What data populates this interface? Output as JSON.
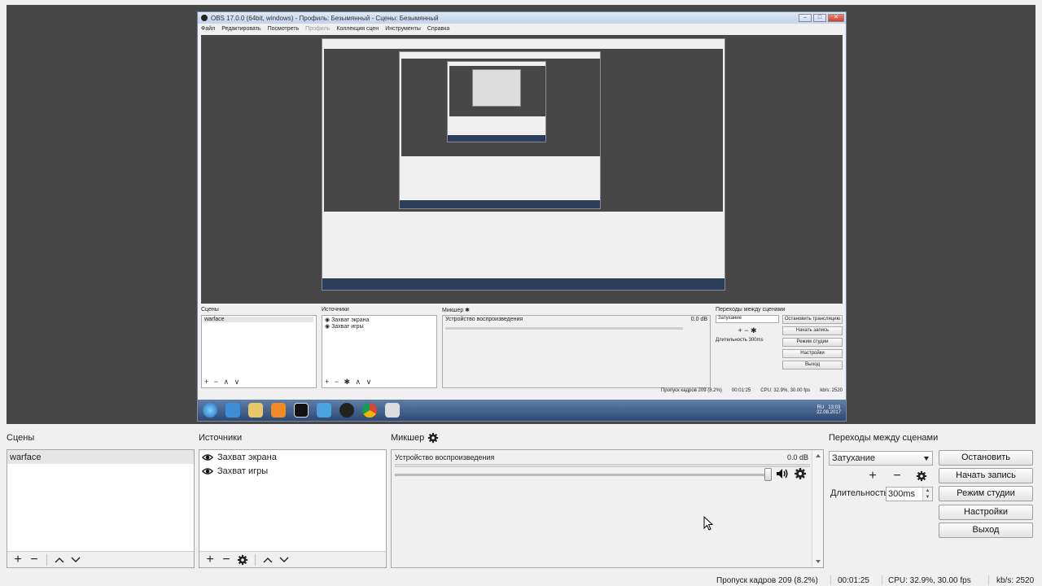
{
  "preview": {
    "window_title": "OBS 17.0.0 (64bit, windows) - Профиль: Безымянный - Сцены: Безымянный",
    "menu": [
      "Файл",
      "Редактировать",
      "Посмотреть",
      "Профиль",
      "Коллекция сцен",
      "Инструменты",
      "Справка"
    ],
    "docks": {
      "scenes_label": "Сцены",
      "sources_label": "Источники",
      "mixer_label": "Микшер",
      "transitions_label": "Переходы между сценами",
      "scene_item": "warface",
      "source_items": [
        "Захват экрана",
        "Захват игры"
      ],
      "mixer_device": "Устройство воспроизведения",
      "mixer_db": "0.0 dB",
      "transition_value": "Затухание",
      "duration_label": "Длительность",
      "duration_value": "300ms",
      "buttons": [
        "Остановить трансляцию",
        "Начать запись",
        "Режим студии",
        "Настройки",
        "Выход"
      ]
    },
    "status": {
      "dropped": "Пропуск кадров 209 (8.2%)",
      "time": "00:01:25",
      "cpu": "CPU: 32.9%, 30.00 fps",
      "kbs": "kb/s: 2520"
    },
    "taskbar": {
      "lang": "RU",
      "clock": "13:03",
      "date": "22.08.2017"
    }
  },
  "docks": {
    "scenes": {
      "label": "Сцены",
      "items": [
        "warface"
      ]
    },
    "sources": {
      "label": "Источники",
      "items": [
        "Захват экрана",
        "Захват игры"
      ]
    },
    "mixer": {
      "label": "Микшер",
      "channel": {
        "name": "Устройство воспроизведения",
        "db": "0.0 dB",
        "volume": 1.0
      }
    },
    "transitions": {
      "label": "Переходы между сценами",
      "selected": "Затухание",
      "duration_label": "Длительность",
      "duration_value": "300ms"
    }
  },
  "controls": {
    "stop_stream": "Остановить трансляцию",
    "start_record": "Начать запись",
    "studio_mode": "Режим студии",
    "settings": "Настройки",
    "exit": "Выход"
  },
  "status": {
    "dropped_frames": "Пропуск кадров 209 (8.2%)",
    "time": "00:01:25",
    "cpu": "CPU: 32.9%, 30.00 fps",
    "kbps": "kb/s: 2520"
  },
  "icons": {
    "add": "plus-icon",
    "remove": "minus-icon",
    "up": "chevron-up-icon",
    "down": "chevron-down-icon",
    "gear": "gear-icon",
    "eye": "eye-icon",
    "speaker": "speaker-icon"
  }
}
